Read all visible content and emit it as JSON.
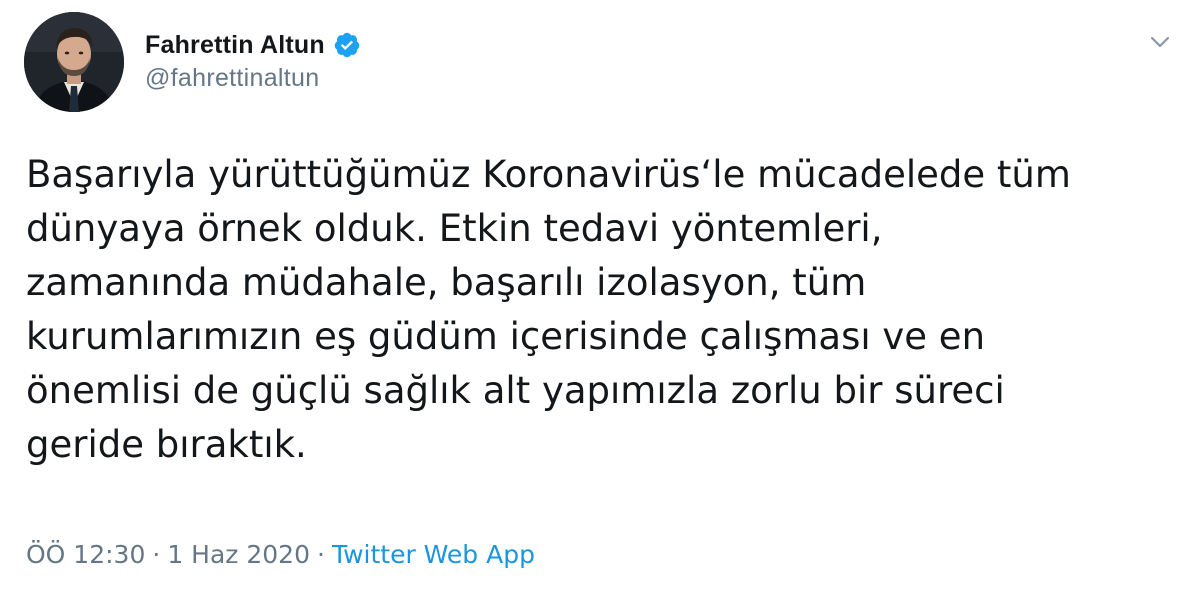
{
  "author": {
    "display_name": "Fahrettin Altun",
    "handle": "@fahrettinaltun",
    "verified": true,
    "avatar_icon": "profile-photo-icon"
  },
  "tweet": {
    "text": "Başarıyla yürüttüğümüz Koronavirüs‘le mücadelede tüm\ndünyaya örnek olduk. Etkin tedavi yöntemleri,\nzamanında müdahale, başarılı izolasyon, tüm\nkurumlarımızın eş güdüm içerisinde çalışması ve en\nönemlisi de güçlü sağlık alt yapımızla zorlu bir süreci\ngeride bıraktık."
  },
  "meta": {
    "time": "ÖÖ 12:30",
    "separator": "·",
    "date": "1 Haz 2020",
    "source": "Twitter Web App"
  },
  "colors": {
    "text": "#14171a",
    "secondary": "#657786",
    "link": "#1b95e0",
    "verified": "#1da1f2"
  },
  "icons": {
    "verified": "verified-badge-icon",
    "menu": "chevron-down-icon"
  }
}
